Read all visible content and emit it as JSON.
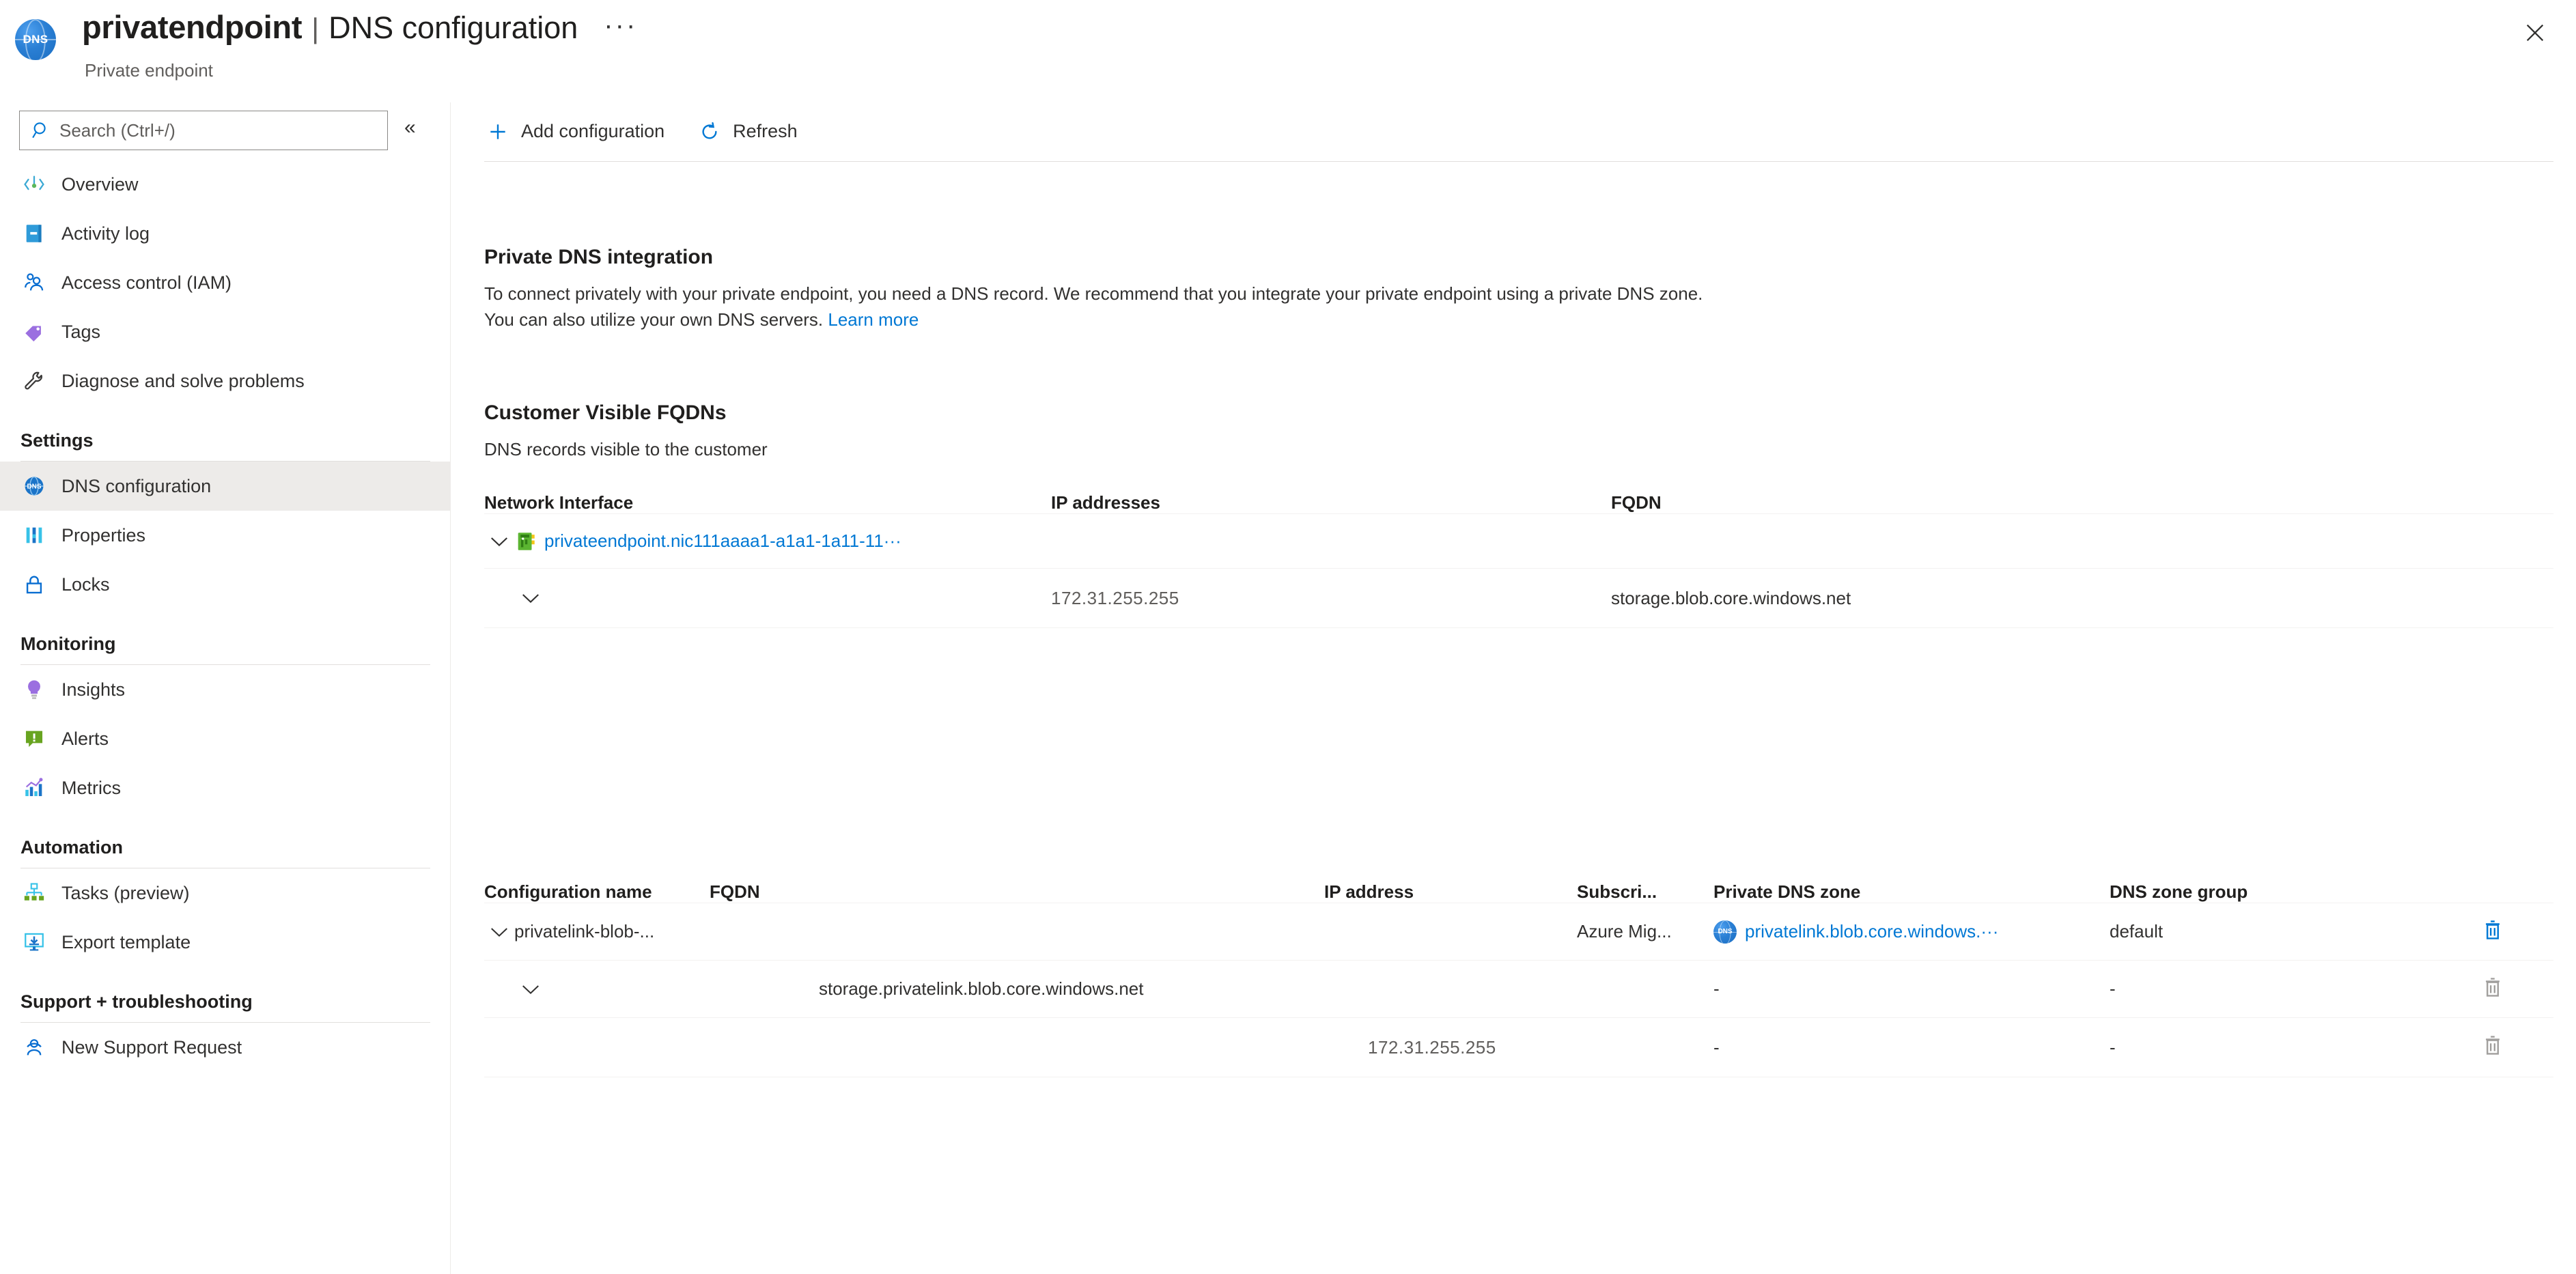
{
  "header": {
    "resource_icon": "dns-zone-icon",
    "title": "privatendpoint",
    "separator": "|",
    "page": "DNS configuration",
    "ellipsis": "···",
    "subtitle": "Private endpoint",
    "close_label": "close-icon"
  },
  "sidebar": {
    "search": {
      "placeholder": "Search (Ctrl+/)",
      "value": ""
    },
    "collapse": "«",
    "groups": [
      {
        "title": null,
        "items": [
          {
            "label": "Overview",
            "icon": "overview-icon",
            "selected": false
          },
          {
            "label": "Activity log",
            "icon": "activity-log-icon",
            "selected": false
          },
          {
            "label": "Access control (IAM)",
            "icon": "access-control-icon",
            "selected": false
          },
          {
            "label": "Tags",
            "icon": "tags-icon",
            "selected": false
          },
          {
            "label": "Diagnose and solve problems",
            "icon": "wrench-icon",
            "selected": false
          }
        ]
      },
      {
        "title": "Settings",
        "items": [
          {
            "label": "DNS configuration",
            "icon": "dns-icon",
            "selected": true
          },
          {
            "label": "Properties",
            "icon": "properties-icon",
            "selected": false
          },
          {
            "label": "Locks",
            "icon": "lock-icon",
            "selected": false
          }
        ]
      },
      {
        "title": "Monitoring",
        "items": [
          {
            "label": "Insights",
            "icon": "lightbulb-icon",
            "selected": false
          },
          {
            "label": "Alerts",
            "icon": "alert-icon",
            "selected": false
          },
          {
            "label": "Metrics",
            "icon": "metrics-icon",
            "selected": false
          }
        ]
      },
      {
        "title": "Automation",
        "items": [
          {
            "label": "Tasks (preview)",
            "icon": "tasks-icon",
            "selected": false
          },
          {
            "label": "Export template",
            "icon": "export-template-icon",
            "selected": false
          }
        ]
      },
      {
        "title": "Support + troubleshooting",
        "items": [
          {
            "label": "New Support Request",
            "icon": "support-icon",
            "selected": false
          }
        ]
      }
    ]
  },
  "toolbar": {
    "add_configuration": "Add configuration",
    "refresh": "Refresh"
  },
  "main": {
    "private_dns_integration": {
      "heading": "Private DNS integration",
      "body_part1": "To connect privately with your private endpoint, you need a DNS record. We recommend that you integrate your private endpoint using a private DNS zone. You can also utilize your own DNS servers. ",
      "learn_more": "Learn more"
    },
    "customer_visible_fqdns": {
      "heading": "Customer Visible FQDNs",
      "subheading": "DNS records visible to the customer",
      "columns": [
        "Network Interface",
        "IP addresses",
        "FQDN"
      ],
      "rows": [
        {
          "expander": "chevron-down-icon",
          "nic_icon": "network-interface-icon",
          "network_interface": "privateendpoint.nic111aaaa1-a1a1-1a11-11···",
          "ip_addresses": "",
          "fqdn": "",
          "is_link": true,
          "indent": 0
        },
        {
          "expander": "chevron-down-icon",
          "nic_icon": null,
          "network_interface": "",
          "ip_addresses": "172.31.255.255",
          "fqdn": "storage.blob.core.windows.net",
          "is_link": false,
          "indent": 1
        }
      ]
    },
    "configurations_table": {
      "columns": [
        "Configuration name",
        "FQDN",
        "IP address",
        "Subscri...",
        "Private DNS zone",
        "DNS zone group"
      ],
      "rows": [
        {
          "expander": "chevron-down-icon",
          "indent": 0,
          "configuration_name": "privatelink-blob-...",
          "fqdn": "",
          "ip_address": "",
          "subscription": "Azure Mig...",
          "private_dns_zone": "privatelink.blob.core.windows.···",
          "private_dns_zone_icon": "dns-zone-icon",
          "dns_zone_group": "default",
          "delete_icon": "trash-icon",
          "delete_enabled": true
        },
        {
          "expander": "chevron-down-icon",
          "indent": 1,
          "configuration_name": "",
          "fqdn": "storage.privatelink.blob.core.windows.net",
          "ip_address": "",
          "subscription": "",
          "private_dns_zone": "-",
          "private_dns_zone_icon": null,
          "dns_zone_group": "-",
          "delete_icon": "trash-icon",
          "delete_enabled": false
        },
        {
          "expander": null,
          "indent": 2,
          "configuration_name": "",
          "fqdn": "",
          "ip_address": "172.31.255.255",
          "subscription": "",
          "private_dns_zone": "-",
          "private_dns_zone_icon": null,
          "dns_zone_group": "-",
          "delete_icon": "trash-icon",
          "delete_enabled": false
        }
      ]
    }
  },
  "colors": {
    "accent": "#0078d4",
    "link": "#0078d4",
    "selected_bg": "#edebe9",
    "rule": "#e1dfdd",
    "row_rule": "#f3f2f1",
    "text": "#323130",
    "muted": "#605e5c"
  }
}
